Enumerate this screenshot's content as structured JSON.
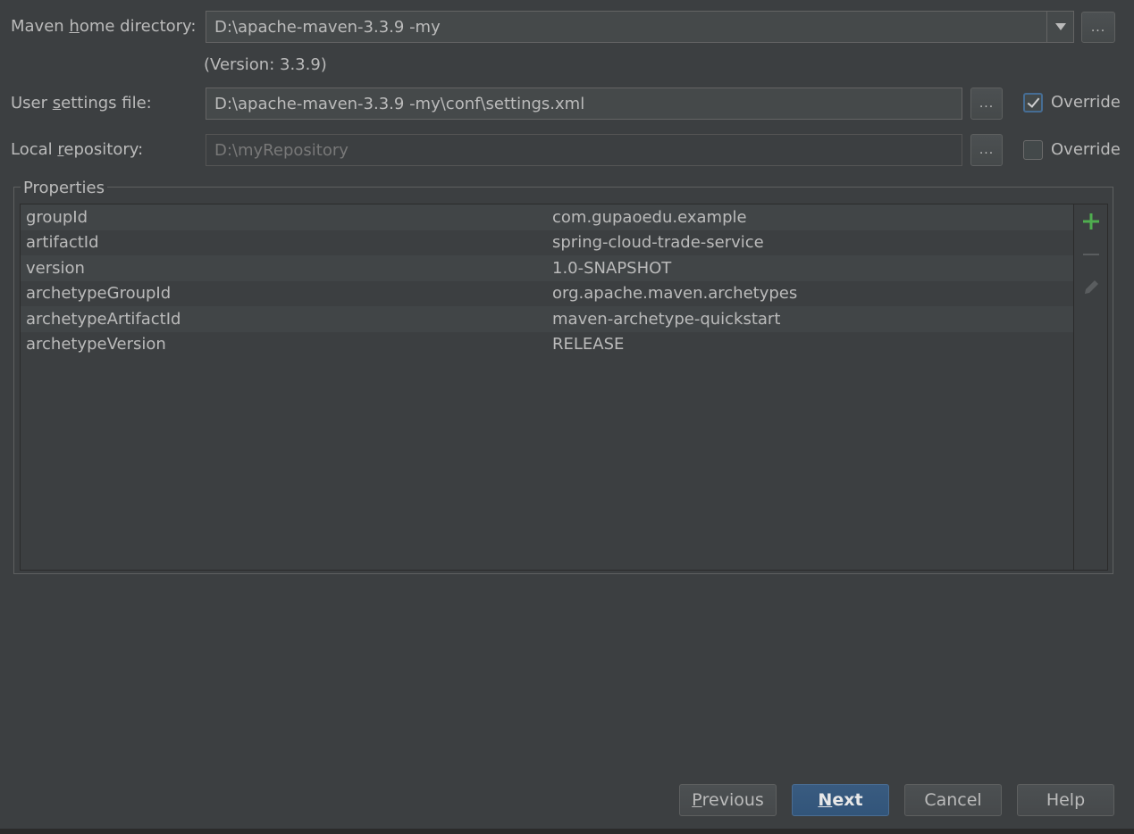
{
  "maven_home": {
    "label_pre": "Maven ",
    "label_u": "h",
    "label_post": "ome directory:",
    "value": "D:\\apache-maven-3.3.9 -my",
    "version_text": "(Version: 3.3.9)",
    "browse_label": "..."
  },
  "user_settings": {
    "label_pre": "User ",
    "label_u": "s",
    "label_post": "ettings file:",
    "value": "D:\\apache-maven-3.3.9 -my\\conf\\settings.xml",
    "browse_label": "...",
    "override_label": "Override",
    "override_checked": true
  },
  "local_repo": {
    "label_pre": "Local ",
    "label_u": "r",
    "label_post": "epository:",
    "value": "D:\\myRepository",
    "browse_label": "...",
    "override_label": "Override",
    "override_checked": false
  },
  "properties": {
    "title": "Properties",
    "rows": [
      {
        "key": "groupId",
        "value": "com.gupaoedu.example"
      },
      {
        "key": "artifactId",
        "value": "spring-cloud-trade-service"
      },
      {
        "key": "version",
        "value": "1.0-SNAPSHOT"
      },
      {
        "key": "archetypeGroupId",
        "value": "org.apache.maven.archetypes"
      },
      {
        "key": "archetypeArtifactId",
        "value": "maven-archetype-quickstart"
      },
      {
        "key": "archetypeVersion",
        "value": "RELEASE"
      }
    ],
    "toolbar": {
      "add_icon": "plus-icon",
      "remove_icon": "minus-icon",
      "edit_icon": "pencil-icon"
    }
  },
  "buttons": {
    "previous_u": "P",
    "previous_rest": "revious",
    "next_u": "N",
    "next_rest": "ext",
    "cancel": "Cancel",
    "help": "Help"
  },
  "colors": {
    "background": "#3c3f41",
    "accent": "#365880",
    "add_green": "#4fae4f"
  }
}
